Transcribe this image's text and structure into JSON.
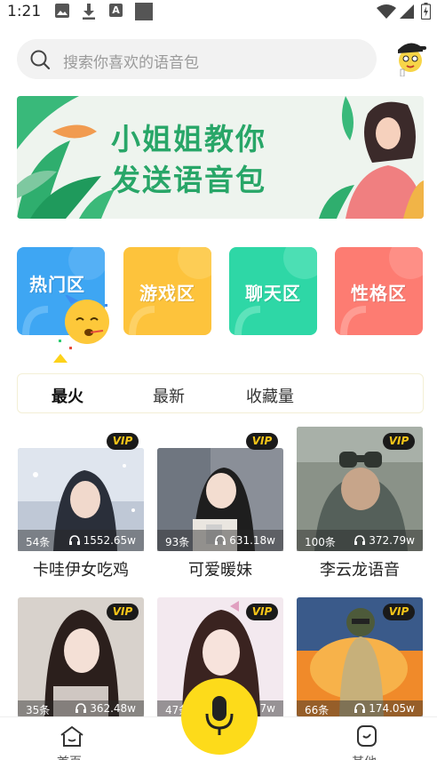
{
  "status_bar": {
    "time": "1:21",
    "icons": [
      "image-icon",
      "download-icon",
      "a-badge-icon",
      "square-icon",
      "wifi-icon",
      "signal-icon",
      "battery-icon"
    ]
  },
  "search": {
    "placeholder": "搜索你喜欢的语音包"
  },
  "banner": {
    "line1": "小姐姐教你",
    "line2": "发送语音包"
  },
  "categories": [
    {
      "label": "热门区",
      "color": "#3ea6f3"
    },
    {
      "label": "游戏区",
      "color": "#fdc33c"
    },
    {
      "label": "聊天区",
      "color": "#2ed7a6"
    },
    {
      "label": "性格区",
      "color": "#fd7c72"
    }
  ],
  "tabs": [
    {
      "label": "最火",
      "active": true
    },
    {
      "label": "最新",
      "active": false
    },
    {
      "label": "收藏量",
      "active": false
    }
  ],
  "cards": [
    {
      "title": "卡哇伊女吃鸡",
      "count": "54条",
      "plays": "1552.65w",
      "badge": "VIP"
    },
    {
      "title": "可爱暖妹",
      "count": "93条",
      "plays": "631.18w",
      "badge": "VIP"
    },
    {
      "title": "李云龙语音",
      "count": "100条",
      "plays": "372.79w",
      "badge": "VIP"
    },
    {
      "title": "",
      "count": "35条",
      "plays": "362.48w",
      "badge": "VIP"
    },
    {
      "title": "",
      "count": "47条",
      "plays": "7w",
      "badge": "VIP"
    },
    {
      "title": "",
      "count": "66条",
      "plays": "174.05w",
      "badge": "VIP"
    }
  ],
  "bottom_nav": {
    "home_label": "首页",
    "other_label": "其他",
    "mic": "microphone-icon"
  },
  "colors": {
    "accent": "#fddb1a",
    "vip_text": "#f5c518",
    "banner_text": "#28a668"
  }
}
